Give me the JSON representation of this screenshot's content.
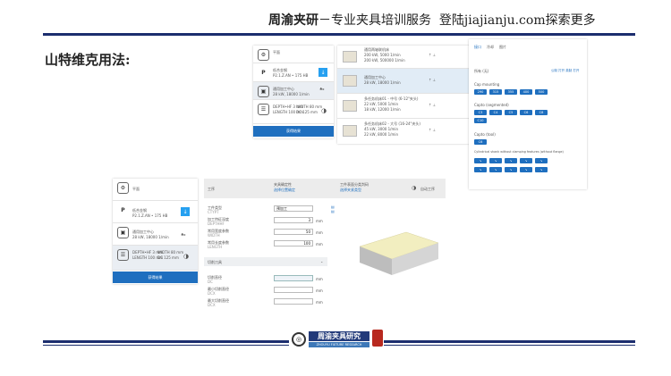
{
  "header": {
    "brand": "周渝夹研",
    "sep": "－",
    "slogan": "专业夹具培训服务",
    "site": "登陆jiajianju.com探索更多"
  },
  "title": "山特维克用法:",
  "watermark": "周渝夹研",
  "panel_a": {
    "r1": "平面",
    "r2a": "低合金钢",
    "r2b": "P2.1.Z.AN • 175 HB",
    "r3a": "通用加工中心",
    "r3b": "28 kW, 18000 1/min",
    "r4a": "DEPTH•HF 3 mm",
    "r4b": "WIDTH 80 mm",
    "r4c": "LENGTH 100 mm",
    "r4d": "DC 125 mm",
    "button": "获得结果"
  },
  "panel_b": {
    "m1a": "通用两轴联机床",
    "m1b": "200 kW, 5000 1/min",
    "m1c": "200 kW, 500000 1/min",
    "m2a": "通用加工中心",
    "m2b": "28 kW, 18000 1/min",
    "m3a": "多任务机床01 - 中号 (6-12\"夹头)",
    "m3b": "22 kW, 5000 1/min",
    "m3c": "18 kW, 12000 1/min",
    "m4a": "多任务机床02 - 大号 (16-24\"夹头)",
    "m4b": "45 kW, 3000 1/min",
    "m4c": "22 kW, 8000 1/min"
  },
  "panel_c": {
    "tabs": [
      "接口",
      "冷却",
      "图片"
    ],
    "none": "所有 (无)",
    "link": "公制 打开  英制 打开",
    "s1": "Cap mounting",
    "s1_chips": [
      "290",
      "315",
      "355",
      "400",
      "500"
    ],
    "s2": "Capto (segmented)",
    "s2_chips": [
      "C3",
      "C4",
      "C5",
      "C6",
      "C8",
      "C10"
    ],
    "s3": "Capto (tool)",
    "s3_chips": [
      "C6"
    ],
    "s4": "Cylindrical shank without clamping features (without flange)"
  },
  "panel_d": {
    "steps": [
      "工序",
      "夹具确定性",
      "工件表面分类判码",
      "自动工序"
    ],
    "step_subs": [
      "",
      "选择位置确定",
      "选择夹紧类型",
      ""
    ],
    "f1": "工件类型",
    "f1b": "CTYPT",
    "f1v": "预加工",
    "f2": "加工特征深度",
    "f2b": "DEPTHHF",
    "f2v": "3",
    "f2u": "mm",
    "f3": "常用宽度参数",
    "f3b": "WIDTH",
    "f3v": "50",
    "f3u": "mm",
    "f4": "常用长度参数",
    "f4b": "LENGTH",
    "f4v": "100",
    "f4u": "mm",
    "sect": "切削刀具",
    "f5": "切削直径",
    "f5b": "DC",
    "f5u": "mm",
    "f6": "最小切削直径",
    "f6b": "DCX",
    "f6u": "mm",
    "f7": "最大切削直径",
    "f7b": "DCX",
    "f7u": "mm"
  },
  "footer": {
    "logo": "周渝夹具研究",
    "sub": "ZHOUYU FIXTURE RESEARCH"
  }
}
